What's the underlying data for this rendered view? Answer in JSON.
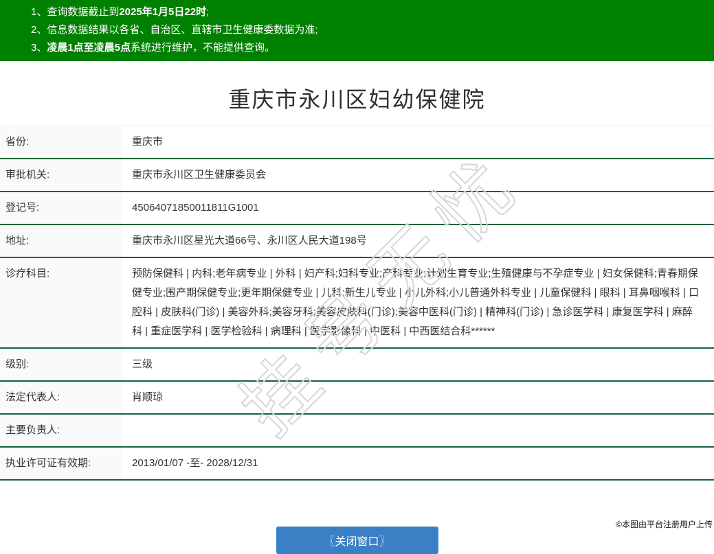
{
  "colors": {
    "banner-green": "#008000",
    "divider-green": "#146438",
    "button-blue": "#3b80c4",
    "label-bg": "#fafafa",
    "watermark-gray": "#d6d6d6"
  },
  "banner": {
    "notices": [
      {
        "pre": "1、查询数据截止到",
        "bold": "2025年1月5日22时",
        "post": ";"
      },
      {
        "pre": "2、信息数据结果以各省、自治区、直辖市卫生健康委数据为准;",
        "bold": "",
        "post": ""
      },
      {
        "pre": "3、",
        "bold": "凌晨1点至凌晨5点",
        "post": "系统进行维护，不能提供查询。"
      }
    ]
  },
  "title": "重庆市永川区妇幼保健院",
  "table": {
    "rows": [
      {
        "label": "省份:",
        "value": "重庆市"
      },
      {
        "label": "审批机关:",
        "value": "重庆市永川区卫生健康委员会"
      },
      {
        "label": "登记号:",
        "value": "45064071850011811G1001"
      },
      {
        "label": "地址:",
        "value": "重庆市永川区星光大道66号、永川区人民大道198号"
      },
      {
        "label": "诊疗科目:",
        "value": "预防保健科 | 内科;老年病专业 | 外科 | 妇产科;妇科专业;产科专业;计划生育专业;生殖健康与不孕症专业 | 妇女保健科;青春期保健专业;围产期保健专业;更年期保健专业 | 儿科;新生儿专业 | 小儿外科;小儿普通外科专业 | 儿童保健科 | 眼科 | 耳鼻咽喉科 | 口腔科 | 皮肤科(门诊) | 美容外科;美容牙科;美容皮肤科(门诊);美容中医科(门诊) | 精神科(门诊) | 急诊医学科 | 康复医学科 | 麻醉科 | 重症医学科 | 医学检验科 | 病理科 | 医学影像科 | 中医科 | 中西医结合科******"
      },
      {
        "label": "级别:",
        "value": "三级"
      },
      {
        "label": "法定代表人:",
        "value": "肖顺琼"
      },
      {
        "label": "主要负责人:",
        "value": ""
      },
      {
        "label": "执业许可证有效期:",
        "value": "2013/01/07 -至- 2028/12/31"
      }
    ]
  },
  "watermark": {
    "text": "挂号无忧"
  },
  "close_button_label": "〖关闭窗口〗",
  "footer_credit": "©本图由平台注册用户上传"
}
